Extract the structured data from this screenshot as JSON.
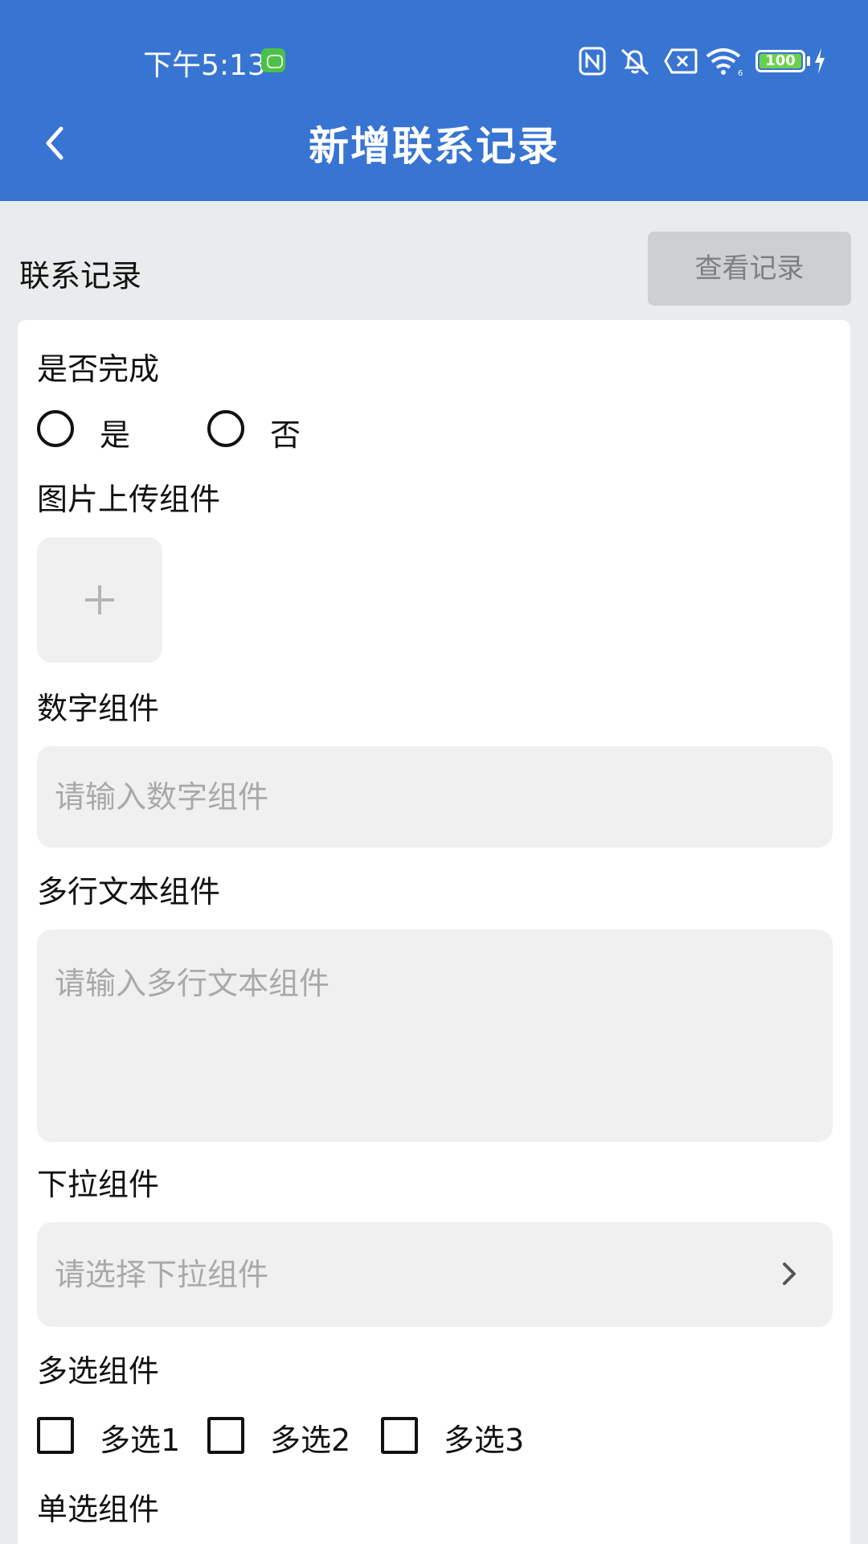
{
  "status_bar": {
    "time": "下午5:13",
    "battery": "100",
    "icons": [
      "app-notification-icon",
      "nfc-icon",
      "mute-icon",
      "sim-error-icon",
      "wifi-icon",
      "battery-icon",
      "charging-icon"
    ]
  },
  "header": {
    "title": "新增联系记录",
    "back_icon": "chevron-left-icon",
    "background_color": "#3874d2"
  },
  "section": {
    "title": "联系记录",
    "view_button_label": "查看记录"
  },
  "form": {
    "completed": {
      "label": "是否完成",
      "options": [
        "是",
        "否"
      ]
    },
    "image_upload": {
      "label": "图片上传组件",
      "icon": "plus-icon"
    },
    "number": {
      "label": "数字组件",
      "placeholder": "请输入数字组件"
    },
    "multiline": {
      "label": "多行文本组件",
      "placeholder": "请输入多行文本组件"
    },
    "dropdown": {
      "label": "下拉组件",
      "placeholder": "请选择下拉组件",
      "icon": "chevron-right-icon"
    },
    "multi_select": {
      "label": "多选组件",
      "options": [
        "多选1",
        "多选2",
        "多选3"
      ]
    },
    "single_select": {
      "label": "单选组件"
    }
  }
}
